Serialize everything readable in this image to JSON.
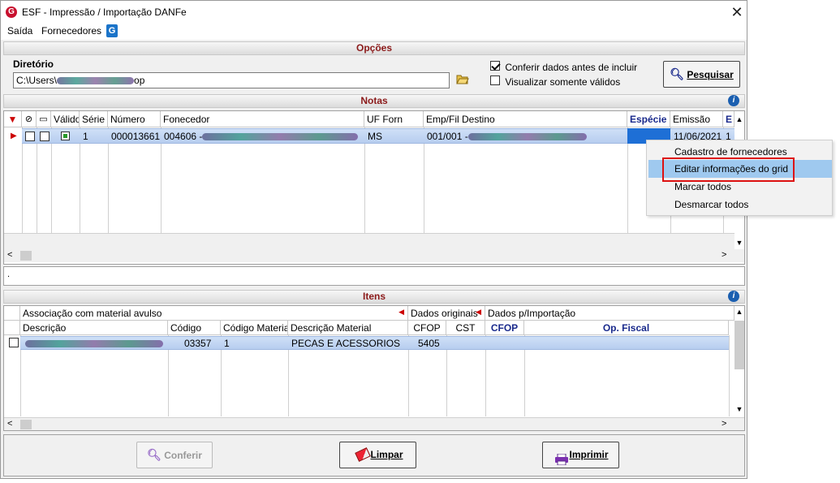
{
  "window": {
    "title": "ESF - Impressão / Importação DANFe",
    "close_glyph": "✕",
    "app_icon": "G"
  },
  "menu": {
    "items": [
      "Saída",
      "Fornecedores"
    ],
    "icon": "G"
  },
  "opcoes": {
    "header": "Opções",
    "dir_label": "Diretório",
    "dir_prefix": "C:\\Users\\",
    "dir_suffix": "op",
    "check_conferir": {
      "label": "Conferir dados antes de incluir",
      "checked": true
    },
    "check_validos": {
      "label": "Visualizar somente válidos",
      "checked": false
    },
    "search_button": "Pesquisar"
  },
  "notas": {
    "header": "Notas",
    "columns": [
      "Válido",
      "Série",
      "Número",
      "Fonecedor",
      "UF Forn",
      "Emp/Fil Destino",
      "Espécie",
      "Emissão",
      "E"
    ],
    "row": {
      "serie": "1",
      "numero": "000013661",
      "fornecedor_code": "004606 -",
      "uf": "MS",
      "emp_fil": "001/001 -",
      "emissao": "11/06/2021",
      "extra": "1"
    },
    "status_text": "."
  },
  "context_menu": {
    "items": [
      "Cadastro de fornecedores",
      "Editar informações do grid",
      "Marcar todos",
      "Desmarcar todos"
    ],
    "highlighted": 1
  },
  "itens": {
    "header": "Itens",
    "group_headers": [
      "Associação com material avulso",
      "Dados originais",
      "Dados p/Importação"
    ],
    "columns": [
      "Descrição",
      "Código",
      "Código Material",
      "Descrição Material",
      "CFOP",
      "CST",
      "CFOP",
      "Op. Fiscal"
    ],
    "row": {
      "codigo": "03357",
      "codigo_material": "1",
      "descricao_material": "PECAS E ACESSORIOS",
      "cfop": "5405"
    }
  },
  "footer": {
    "conferir": "Conferir",
    "limpar": "Limpar",
    "imprimir": "Imprimir"
  },
  "colors": {
    "accent_header": "#8b1a1a",
    "selection": "#b7cdef",
    "highlight": "#9fc9ef",
    "red_box": "#d11111"
  }
}
